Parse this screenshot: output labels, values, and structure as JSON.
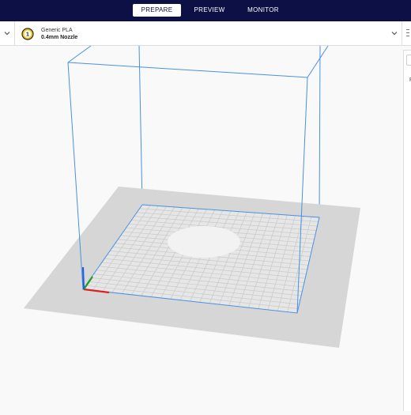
{
  "stages": {
    "prepare": "PREPARE",
    "preview": "PREVIEW",
    "monitor": "MONITOR",
    "active": "prepare"
  },
  "printer_config": {
    "extruder_number": "1",
    "material": "Generic PLA",
    "nozzle": "0.4mm Nozzle"
  },
  "icons": {
    "left_dropdown": "chevron-down-icon",
    "right_dropdown": "chevron-down-icon",
    "extruder": "extruder-badge-icon",
    "axes": "axis-gizmo-icon"
  },
  "colors": {
    "topbar": "#0c1045",
    "build_volume_edges": "#4a90e2",
    "axis_x": "#e02020",
    "axis_y": "#20a020",
    "axis_z": "#2060e0",
    "extruder_badge": "#f2c200"
  },
  "side_panel": {
    "glyph": "P"
  }
}
